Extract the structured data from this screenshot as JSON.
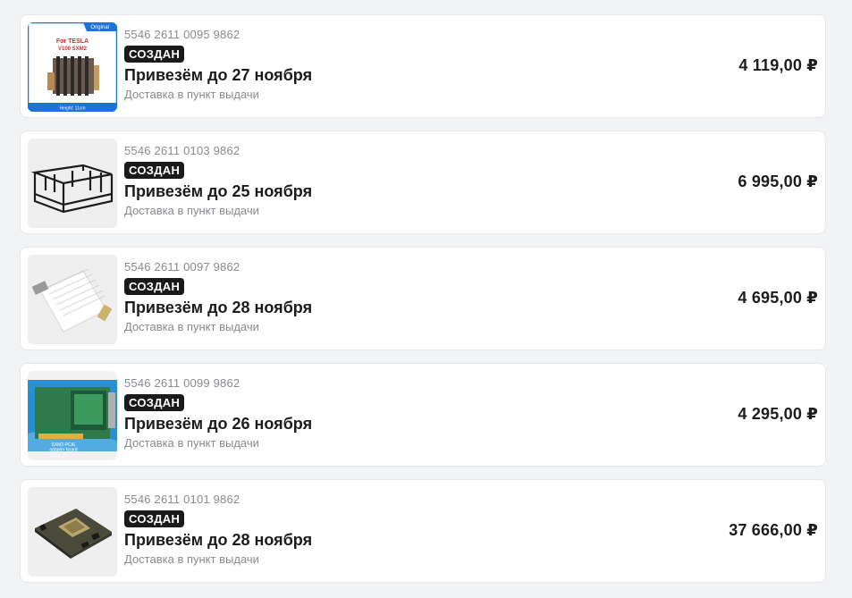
{
  "orders": [
    {
      "number": "5546 2611 0095 9862",
      "status": "СОЗДАН",
      "eta": "Привезём до 27 ноября",
      "delivery": "Доставка в пункт выдачи",
      "price": "4 119,00 ₽",
      "image_icon": "gpu-heatsink-product-image",
      "image_text": {
        "corner": "Original",
        "title1": "For TESLA",
        "title2": "V100 SXM2",
        "bottom": "Height: 11cm"
      }
    },
    {
      "number": "5546 2611 0103 9862",
      "status": "СОЗДАН",
      "eta": "Привезём до 25 ноября",
      "delivery": "Доставка в пункт выдачи",
      "price": "6 995,00 ₽",
      "image_icon": "mining-frame-product-image"
    },
    {
      "number": "5546 2611 0097 9862",
      "status": "СОЗДАН",
      "eta": "Привезём до 28 ноября",
      "delivery": "Доставка в пункт выдачи",
      "price": "4 695,00 ₽",
      "image_icon": "riser-cable-product-image"
    },
    {
      "number": "5546 2611 0099 9862",
      "status": "СОЗДАН",
      "eta": "Привезём до 26 ноября",
      "delivery": "Доставка в пункт выдачи",
      "price": "4 295,00 ₽",
      "image_icon": "pcie-adapter-board-product-image",
      "image_text": {
        "line1": "SXM2-PCIE",
        "line2": "adapter board"
      }
    },
    {
      "number": "5546 2611 0101 9862",
      "status": "СОЗДАН",
      "eta": "Привезём до 28 ноября",
      "delivery": "Доставка в пункт выдачи",
      "price": "37 666,00 ₽",
      "image_icon": "gpu-module-product-image"
    }
  ]
}
